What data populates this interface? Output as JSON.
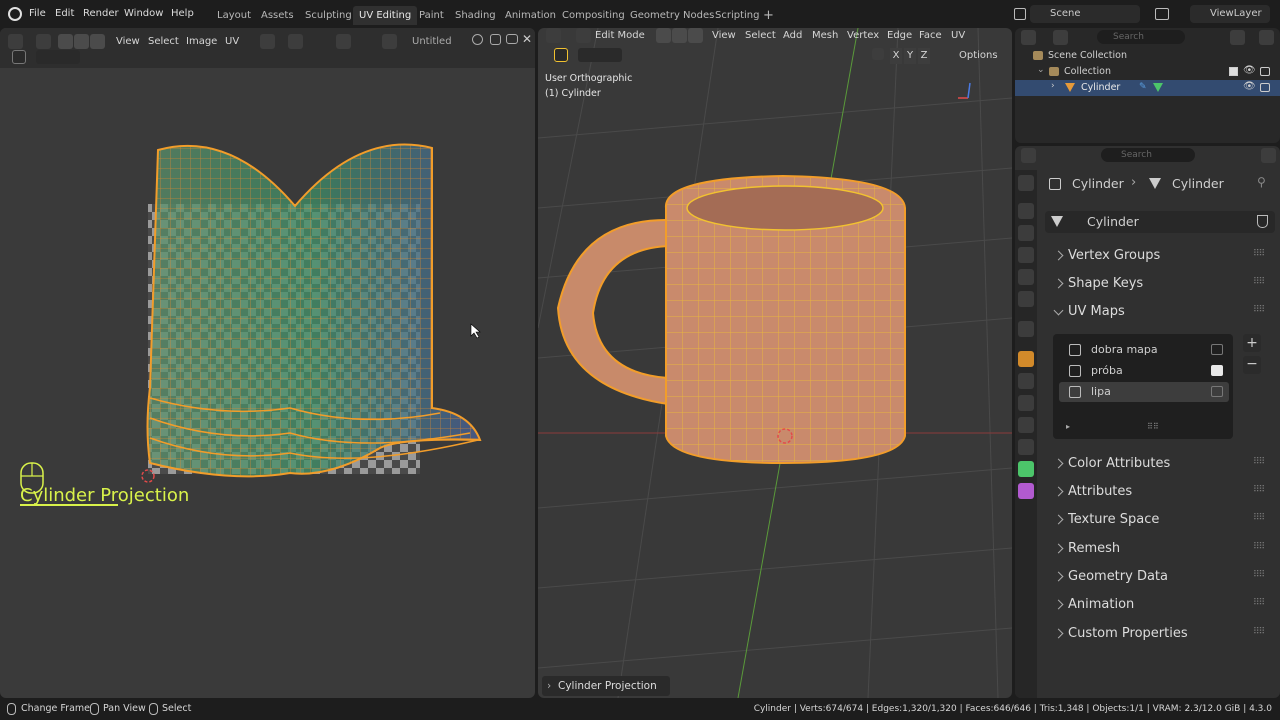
{
  "topbar": {
    "menus": [
      "File",
      "Edit",
      "Render",
      "Window",
      "Help"
    ],
    "workspaces": [
      "Layout",
      "Assets",
      "Sculpting",
      "UV Editing",
      "Paint",
      "Shading",
      "Animation",
      "Compositing",
      "Geometry Nodes",
      "Scripting"
    ],
    "add_tab": "+",
    "scene": "Scene",
    "view_layer": "ViewLayer"
  },
  "uv_editor": {
    "menus": [
      "View",
      "Select",
      "Image",
      "UV"
    ],
    "image_name": "Untitled",
    "overlay_title": "Cylinder Projection"
  },
  "viewport": {
    "mode": "Edit Mode",
    "menus": [
      "View",
      "Select",
      "Add",
      "Mesh",
      "Vertex",
      "Edge",
      "Face",
      "UV"
    ],
    "axes": [
      "X",
      "Y",
      "Z"
    ],
    "options_label": "Options",
    "view_name": "User Orthographic",
    "object_label": "(1) Cylinder",
    "operator_panel": "Cylinder Projection"
  },
  "outliner": {
    "search_placeholder": "Search",
    "scene_collection": "Scene Collection",
    "collection": "Collection",
    "object": "Cylinder"
  },
  "properties": {
    "search_placeholder": "Search",
    "breadcrumb_object": "Cylinder",
    "breadcrumb_data": "Cylinder",
    "mesh_name": "Cylinder",
    "panels_top": [
      "Vertex Groups",
      "Shape Keys",
      "UV Maps"
    ],
    "uv_maps": [
      {
        "name": "dobra mapa"
      },
      {
        "name": "próba"
      },
      {
        "name": "lipa"
      }
    ],
    "panels_bottom": [
      "Color Attributes",
      "Attributes",
      "Texture Space",
      "Remesh",
      "Geometry Data",
      "Animation",
      "Custom Properties"
    ]
  },
  "statusbar": {
    "hints": [
      "Change Frame",
      "Pan View",
      "Select"
    ],
    "stats": "Cylinder | Verts:674/674 | Edges:1,320/1,320 | Faces:646/646 | Tris:1,348 | Objects:1/1 | VRAM: 2.3/12.0 GiB | 4.3.0"
  },
  "colors": {
    "accent": "#4772b3",
    "mesh_wire": "#f29d2a",
    "overlay_text": "#d9f24a",
    "uv_grid_green": "#3e8f66"
  }
}
